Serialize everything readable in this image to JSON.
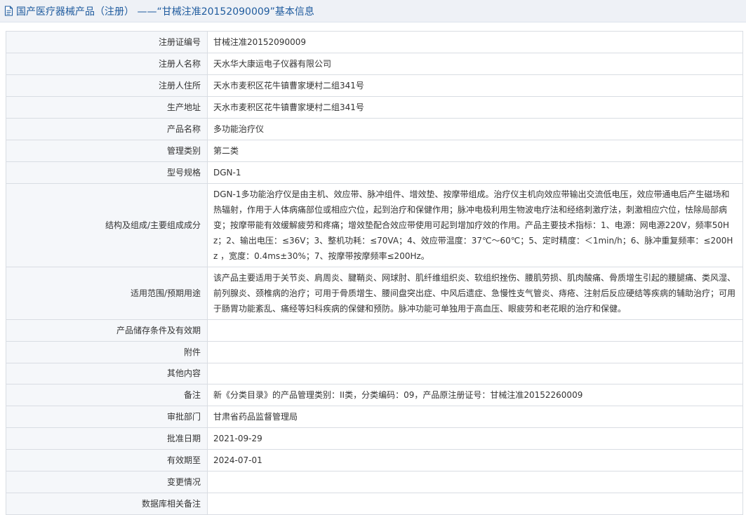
{
  "header": {
    "title": "国产医疗器械产品（注册） ——“甘械注准20152090009”基本信息"
  },
  "rows": [
    {
      "label": "注册证编号",
      "value": "甘械注准20152090009"
    },
    {
      "label": "注册人名称",
      "value": "天水华大康运电子仪器有限公司"
    },
    {
      "label": "注册人住所",
      "value": "天水市麦积区花牛镇曹家埂村二组341号"
    },
    {
      "label": "生产地址",
      "value": "天水市麦积区花牛镇曹家埂村二组341号"
    },
    {
      "label": "产品名称",
      "value": "多功能治疗仪"
    },
    {
      "label": "管理类别",
      "value": "第二类"
    },
    {
      "label": "型号规格",
      "value": "DGN-1"
    },
    {
      "label": "结构及组成/主要组成成分",
      "value": "DGN-1多功能治疗仪是由主机、效应带、脉冲组件、增效垫、按摩带组成。治疗仪主机向效应带输出交流低电压，效应带通电后产生磁场和热辐射，作用于人体病痛部位或相应穴位，起到治疗和保健作用；脉冲电极利用生物波电疗法和经络刺激疗法，刺激相应穴位，怯除局部病变；按摩带能有效缓解疲劳和疼痛；增效垫配合效应带使用可起到增加疗效的作用。产品主要技术指标：1、电源：网电源220V，频率50Hz；2、输出电压：≤36V；3、整机功耗：≤70VA；4、效应带温度：37℃～60℃；5、定时精度：＜1min/h；6、脉冲重复频率：≤200Hz ，宽度：0.4ms±30%；7、按摩带按摩频率≤200Hz。"
    },
    {
      "label": "适用范围/预期用途",
      "value": "该产品主要适用于关节炎、肩周炎、腱鞘炎、网球肘、肌纤维组织炎、软组织挫伤、腰肌劳损、肌肉酸痛、骨质增生引起的腰腿痛、类风湿、前列腺炎、颈椎病的治疗；可用于骨质增生、腰间盘突出症、中风后遗症、急慢性支气管炎、痔疮、注射后反应硬结等疾病的辅助治疗；可用于肠胃功能紊乱、痛经等妇科疾病的保健和预防。脉冲功能可单独用于高血压、眼疲劳和老花眼的治疗和保健。"
    },
    {
      "label": "产品储存条件及有效期",
      "value": ""
    },
    {
      "label": "附件",
      "value": ""
    },
    {
      "label": "其他内容",
      "value": ""
    },
    {
      "label": "备注",
      "value": "新《分类目录》的产品管理类别：II类，分类编码：09，产品原注册证号：甘械注准20152260009"
    },
    {
      "label": "审批部门",
      "value": "甘肃省药品监督管理局"
    },
    {
      "label": "批准日期",
      "value": "2021-09-29"
    },
    {
      "label": "有效期至",
      "value": "2024-07-01"
    },
    {
      "label": "变更情况",
      "value": ""
    },
    {
      "label": "数据库相关备注",
      "value": ""
    }
  ],
  "colors": {
    "title": "#1f5b9e",
    "title_bg": "#eef1f6",
    "label_bg": "#f5f7fa",
    "border": "#d9dde3"
  },
  "icons": {
    "title_icon": "document-icon"
  }
}
